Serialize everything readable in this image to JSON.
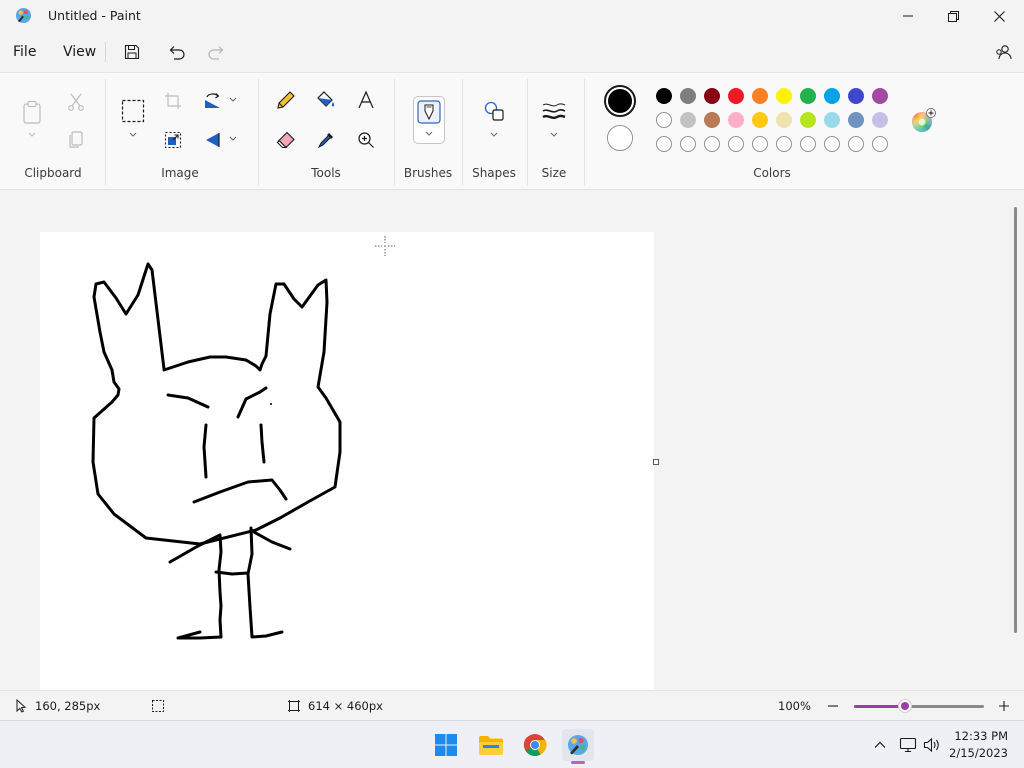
{
  "window": {
    "title": "Untitled - Paint"
  },
  "menu": {
    "file": "File",
    "view": "View"
  },
  "ribbon": {
    "groups": {
      "clipboard": "Clipboard",
      "image": "Image",
      "tools": "Tools",
      "brushes": "Brushes",
      "shapes": "Shapes",
      "size": "Size",
      "colors": "Colors"
    },
    "primary_color": "#000000",
    "secondary_color": "#ffffff",
    "palette_row1": [
      "#000000",
      "#7f7f7f",
      "#880015",
      "#ed1c24",
      "#ff7f27",
      "#fff200",
      "#22b14c",
      "#00a2e8",
      "#3f48cc",
      "#a349a4"
    ],
    "palette_row2": [
      "#ffffff",
      "#c3c3c3",
      "#b97a57",
      "#ffaec9",
      "#ffc90e",
      "#efe4b0",
      "#b5e61d",
      "#99d9ea",
      "#7092be",
      "#c8bfe7"
    ],
    "palette_row3_empty_slots": 10
  },
  "status": {
    "cursor_position": "160, 285px",
    "canvas_size": "614 × 460px",
    "zoom": "100%",
    "zoom_slider_fraction": 0.39
  },
  "taskbar": {
    "time": "12:33 PM",
    "date": "2/15/2023",
    "apps": [
      "start-icon",
      "file-explorer-icon",
      "chrome-icon",
      "paint-icon"
    ]
  }
}
